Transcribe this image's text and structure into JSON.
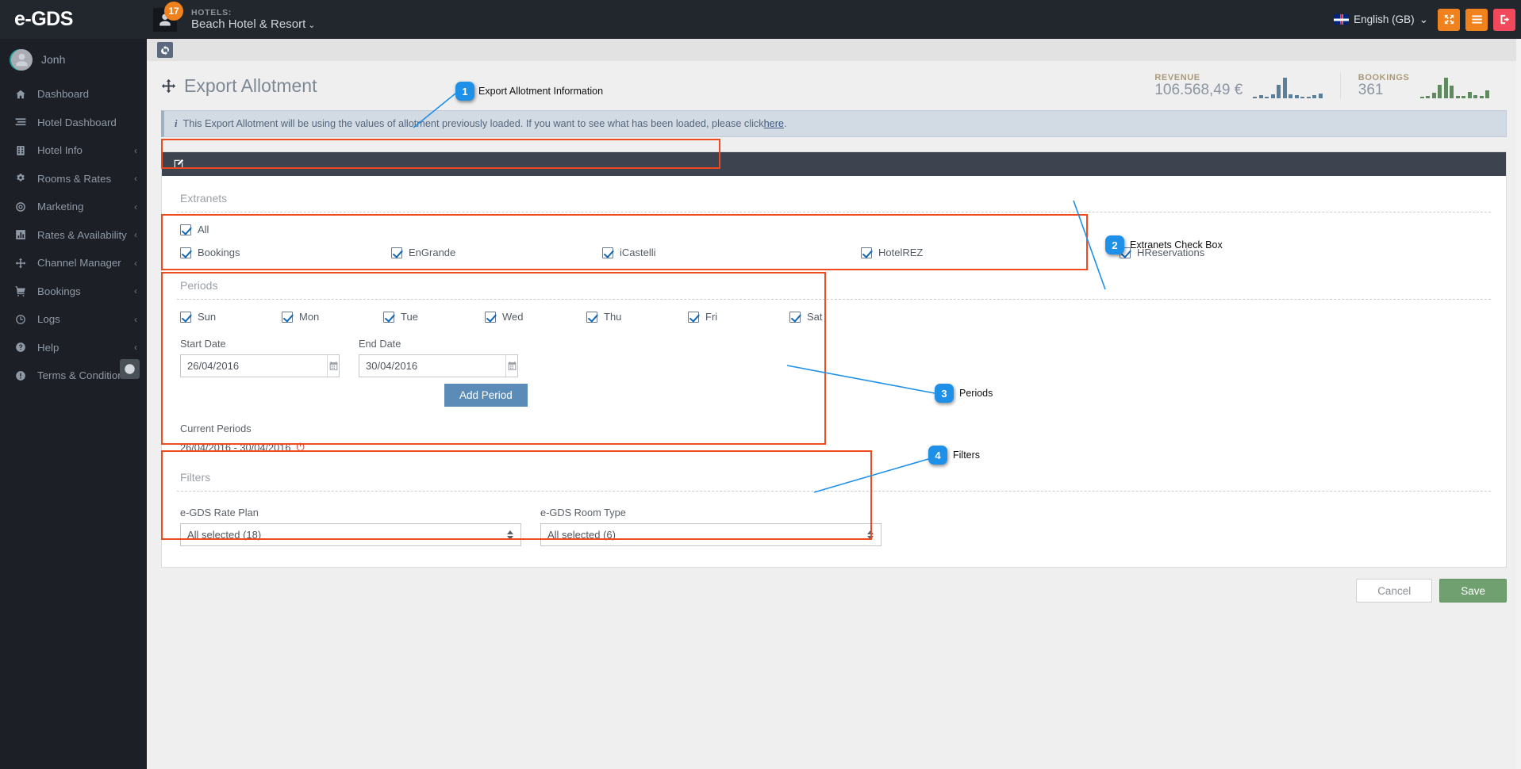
{
  "topbar": {
    "brand": "e-GDS",
    "notification_count": "17",
    "hotels_label": "HOTELS:",
    "hotel_name": "Beach Hotel & Resort",
    "hotel_caret": "⌄",
    "language": "English (GB)",
    "language_caret": "⌄",
    "buttons": [
      {
        "name": "expand-button",
        "icon": "expand-arrows-icon"
      },
      {
        "name": "menu-button",
        "icon": "hamburger-icon"
      },
      {
        "name": "logout-button",
        "icon": "logout-icon"
      }
    ]
  },
  "sidebar": {
    "user": "Jonh",
    "items": [
      {
        "label": "Dashboard",
        "icon": "home-icon",
        "arrow": ""
      },
      {
        "label": "Hotel Dashboard",
        "icon": "list-icon",
        "arrow": ""
      },
      {
        "label": "Hotel Info",
        "icon": "building-icon",
        "arrow": "‹"
      },
      {
        "label": "Rooms & Rates",
        "icon": "gears-icon",
        "arrow": "‹"
      },
      {
        "label": "Marketing",
        "icon": "target-icon",
        "arrow": "‹"
      },
      {
        "label": "Rates & Availability",
        "icon": "bar-chart-icon",
        "arrow": "‹"
      },
      {
        "label": "Channel Manager",
        "icon": "arrows-move-icon",
        "arrow": "‹"
      },
      {
        "label": "Bookings",
        "icon": "cart-icon",
        "arrow": "‹"
      },
      {
        "label": "Logs",
        "icon": "clock-icon",
        "arrow": "‹"
      },
      {
        "label": "Help",
        "icon": "question-circle-icon",
        "arrow": "‹"
      },
      {
        "label": "Terms & Conditions",
        "icon": "exclamation-circle-icon",
        "arrow": ""
      }
    ]
  },
  "page": {
    "title": "Export Allotment",
    "title_icon": "arrows-move-icon",
    "refresh_icon": "refresh-icon",
    "edit_icon": "edit-square-icon"
  },
  "stats": {
    "revenue_label": "REVENUE",
    "revenue_value": "106.568,49 €",
    "bookings_label": "BOOKINGS",
    "bookings_value": "361",
    "revenue_color": "#5b7f99",
    "bookings_color": "#5f8a5f",
    "revenue_spark": [
      2,
      3,
      2,
      4,
      14,
      22,
      4,
      3,
      2,
      2,
      3,
      5
    ],
    "bookings_spark": [
      2,
      3,
      6,
      16,
      24,
      15,
      3,
      3,
      7,
      4,
      3,
      9
    ]
  },
  "alert": {
    "icon": "info-icon",
    "text_before": "This Export Allotment will be using the values of allotment previously loaded. If you want to see what has been loaded, please click ",
    "link": "here",
    "text_after": "."
  },
  "extranets": {
    "legend": "Extranets",
    "all_label": "All",
    "options": [
      "Bookings",
      "EnGrande",
      "iCastelli",
      "HotelREZ",
      "HReservations"
    ]
  },
  "periods": {
    "legend": "Periods",
    "days": [
      "Sun",
      "Mon",
      "Tue",
      "Wed",
      "Thu",
      "Fri",
      "Sat"
    ],
    "start_date_label": "Start Date",
    "start_date_value": "26/04/2016",
    "end_date_label": "End Date",
    "end_date_value": "30/04/2016",
    "add_period_label": "Add Period",
    "current_periods_label": "Current Periods",
    "current_period_value": "26/04/2016 - 30/04/2016",
    "remove_icon": "power-icon"
  },
  "filters": {
    "legend": "Filters",
    "rate_plan_label": "e-GDS Rate Plan",
    "rate_plan_value": "All selected (18)",
    "room_type_label": "e-GDS Room Type",
    "room_type_value": "All selected (6)"
  },
  "footer": {
    "cancel_label": "Cancel",
    "save_label": "Save"
  },
  "annotations": [
    {
      "number": "1",
      "text": "Export Allotment Information"
    },
    {
      "number": "2",
      "text": "Extranets Check Box"
    },
    {
      "number": "3",
      "text": "Periods"
    },
    {
      "number": "4",
      "text": "Filters"
    }
  ],
  "colors": {
    "accent_orange": "#f0821e",
    "annotation_red": "#f04a1e",
    "annotation_blue": "#1e90e8",
    "save_green": "#70a070",
    "button_blue": "#5b8cb8"
  }
}
